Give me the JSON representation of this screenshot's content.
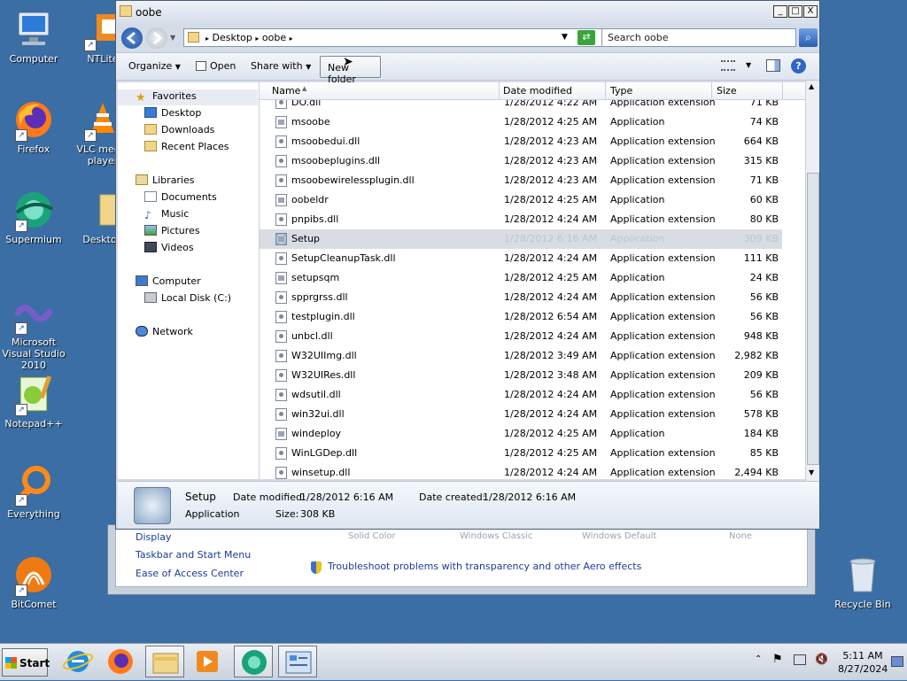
{
  "desktop": {
    "icons_left": [
      {
        "label": "Computer"
      },
      {
        "label": "Firefox"
      },
      {
        "label": "Supermium"
      },
      {
        "label": "Microsoft Visual Studio 2010"
      },
      {
        "label": "Notepad++"
      },
      {
        "label": "Everything"
      },
      {
        "label": "BitComet"
      }
    ],
    "icons_second": [
      {
        "label": "NTLite"
      },
      {
        "label": "VLC media player"
      },
      {
        "label": "Desktop"
      }
    ],
    "recycle_bin": "Recycle Bin"
  },
  "background_window": {
    "links": [
      "Display",
      "Taskbar and Start Menu",
      "Ease of Access Center"
    ],
    "troubleshoot": "Troubleshoot problems with transparency and other Aero effects",
    "faded_labels": [
      "Solid Color",
      "Windows Classic",
      "Windows Default",
      "None"
    ]
  },
  "window": {
    "title": "oobe",
    "controls": {
      "minimize": "_",
      "maximize": "□",
      "close": "X"
    },
    "breadcrumbs": [
      "Desktop",
      "oobe"
    ],
    "search_placeholder": "Search oobe",
    "toolbar": {
      "organize": "Organize",
      "open": "Open",
      "share_with": "Share with",
      "new_folder": "New folder"
    },
    "nav": {
      "favorites": "Favorites",
      "favorites_items": [
        "Desktop",
        "Downloads",
        "Recent Places"
      ],
      "libraries": "Libraries",
      "libraries_items": [
        "Documents",
        "Music",
        "Pictures",
        "Videos"
      ],
      "computer": "Computer",
      "computer_items": [
        "Local Disk (C:)"
      ],
      "network": "Network"
    },
    "columns": [
      "Name",
      "Date modified",
      "Type",
      "Size"
    ],
    "files": [
      {
        "name": "DO.dll",
        "date": "1/28/2012 4:22 AM",
        "type": "Application extension",
        "size": "71 KB",
        "kind": "dll"
      },
      {
        "name": "msoobe",
        "date": "1/28/2012 4:25 AM",
        "type": "Application",
        "size": "74 KB",
        "kind": "app"
      },
      {
        "name": "msoobedui.dll",
        "date": "1/28/2012 4:23 AM",
        "type": "Application extension",
        "size": "664 KB",
        "kind": "dll"
      },
      {
        "name": "msoobeplugins.dll",
        "date": "1/28/2012 4:23 AM",
        "type": "Application extension",
        "size": "315 KB",
        "kind": "dll"
      },
      {
        "name": "msoobewirelessplugin.dll",
        "date": "1/28/2012 4:23 AM",
        "type": "Application extension",
        "size": "71 KB",
        "kind": "dll"
      },
      {
        "name": "oobeldr",
        "date": "1/28/2012 4:25 AM",
        "type": "Application",
        "size": "60 KB",
        "kind": "app"
      },
      {
        "name": "pnpibs.dll",
        "date": "1/28/2012 4:24 AM",
        "type": "Application extension",
        "size": "80 KB",
        "kind": "dll"
      },
      {
        "name": "Setup",
        "date": "1/28/2012 6:16 AM",
        "type": "Application",
        "size": "309 KB",
        "kind": "setup",
        "selected": true
      },
      {
        "name": "SetupCleanupTask.dll",
        "date": "1/28/2012 4:24 AM",
        "type": "Application extension",
        "size": "111 KB",
        "kind": "dll"
      },
      {
        "name": "setupsqm",
        "date": "1/28/2012 4:25 AM",
        "type": "Application",
        "size": "24 KB",
        "kind": "app"
      },
      {
        "name": "spprgrss.dll",
        "date": "1/28/2012 4:24 AM",
        "type": "Application extension",
        "size": "56 KB",
        "kind": "dll"
      },
      {
        "name": "testplugin.dll",
        "date": "1/28/2012 6:54 AM",
        "type": "Application extension",
        "size": "56 KB",
        "kind": "dll"
      },
      {
        "name": "unbcl.dll",
        "date": "1/28/2012 4:24 AM",
        "type": "Application extension",
        "size": "948 KB",
        "kind": "dll"
      },
      {
        "name": "W32UIImg.dll",
        "date": "1/28/2012 3:49 AM",
        "type": "Application extension",
        "size": "2,982 KB",
        "kind": "dll"
      },
      {
        "name": "W32UIRes.dll",
        "date": "1/28/2012 3:48 AM",
        "type": "Application extension",
        "size": "209 KB",
        "kind": "dll"
      },
      {
        "name": "wdsutil.dll",
        "date": "1/28/2012 4:24 AM",
        "type": "Application extension",
        "size": "56 KB",
        "kind": "dll"
      },
      {
        "name": "win32ui.dll",
        "date": "1/28/2012 4:24 AM",
        "type": "Application extension",
        "size": "578 KB",
        "kind": "dll"
      },
      {
        "name": "windeploy",
        "date": "1/28/2012 4:25 AM",
        "type": "Application",
        "size": "184 KB",
        "kind": "app"
      },
      {
        "name": "WinLGDep.dll",
        "date": "1/28/2012 4:25 AM",
        "type": "Application extension",
        "size": "85 KB",
        "kind": "dll"
      },
      {
        "name": "winsetup.dll",
        "date": "1/28/2012 4:24 AM",
        "type": "Application extension",
        "size": "2,494 KB",
        "kind": "dll"
      }
    ],
    "details": {
      "name": "Setup",
      "type": "Application",
      "date_modified_label": "Date modified:",
      "date_modified": "1/28/2012 6:16 AM",
      "date_created_label": "Date created:",
      "date_created": "1/28/2012 6:16 AM",
      "size_label": "Size:",
      "size": "308 KB"
    }
  },
  "taskbar": {
    "start": "Start",
    "apps": [
      "internet-explorer",
      "firefox",
      "explorer",
      "media-player",
      "supermium",
      "control-panel"
    ],
    "time": "5:11 AM",
    "date": "8/27/2024"
  },
  "colors": {
    "desktop": "#3a6ea5",
    "selection": "#d9dde3",
    "link": "#1a3c9a"
  }
}
